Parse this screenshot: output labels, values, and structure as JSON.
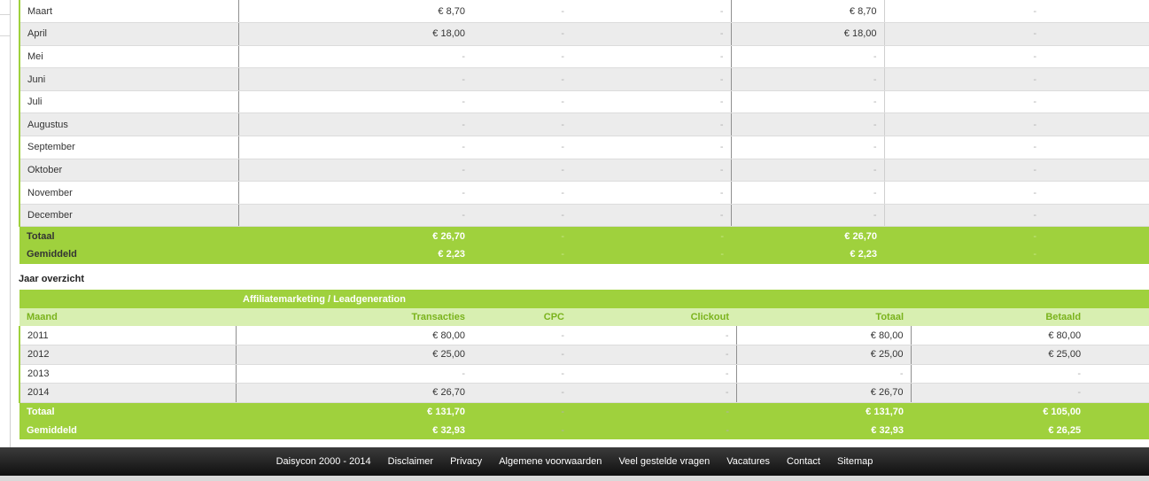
{
  "monthly": {
    "rows": [
      {
        "month": "Maart",
        "transacties": "€ 8,70",
        "cpc": "-",
        "clickout": "-",
        "totaal": "€ 8,70",
        "betaald": "-"
      },
      {
        "month": "April",
        "transacties": "€ 18,00",
        "cpc": "-",
        "clickout": "-",
        "totaal": "€ 18,00",
        "betaald": "-"
      },
      {
        "month": "Mei",
        "transacties": "-",
        "cpc": "-",
        "clickout": "-",
        "totaal": "-",
        "betaald": "-"
      },
      {
        "month": "Juni",
        "transacties": "-",
        "cpc": "-",
        "clickout": "-",
        "totaal": "-",
        "betaald": "-"
      },
      {
        "month": "Juli",
        "transacties": "-",
        "cpc": "-",
        "clickout": "-",
        "totaal": "-",
        "betaald": "-"
      },
      {
        "month": "Augustus",
        "transacties": "-",
        "cpc": "-",
        "clickout": "-",
        "totaal": "-",
        "betaald": "-"
      },
      {
        "month": "September",
        "transacties": "-",
        "cpc": "-",
        "clickout": "-",
        "totaal": "-",
        "betaald": "-"
      },
      {
        "month": "Oktober",
        "transacties": "-",
        "cpc": "-",
        "clickout": "-",
        "totaal": "-",
        "betaald": "-"
      },
      {
        "month": "November",
        "transacties": "-",
        "cpc": "-",
        "clickout": "-",
        "totaal": "-",
        "betaald": "-"
      },
      {
        "month": "December",
        "transacties": "-",
        "cpc": "-",
        "clickout": "-",
        "totaal": "-",
        "betaald": "-"
      }
    ],
    "totaal": {
      "label": "Totaal",
      "transacties": "€ 26,70",
      "cpc": "-",
      "clickout": "-",
      "totaal": "€ 26,70",
      "betaald": "-"
    },
    "gemiddeld": {
      "label": "Gemiddeld",
      "transacties": "€ 2,23",
      "cpc": "-",
      "clickout": "-",
      "totaal": "€ 2,23",
      "betaald": "-"
    }
  },
  "yearly": {
    "title": "Jaar overzicht",
    "group_header": "Affiliatemarketing / Leadgeneration",
    "columns": {
      "maand": "Maand",
      "transacties": "Transacties",
      "cpc": "CPC",
      "clickout": "Clickout",
      "totaal": "Totaal",
      "betaald": "Betaald"
    },
    "rows": [
      {
        "year": "2011",
        "transacties": "€ 80,00",
        "cpc": "-",
        "clickout": "-",
        "totaal": "€ 80,00",
        "betaald": "€ 80,00"
      },
      {
        "year": "2012",
        "transacties": "€ 25,00",
        "cpc": "-",
        "clickout": "-",
        "totaal": "€ 25,00",
        "betaald": "€ 25,00"
      },
      {
        "year": "2013",
        "transacties": "-",
        "cpc": "-",
        "clickout": "-",
        "totaal": "-",
        "betaald": "-"
      },
      {
        "year": "2014",
        "transacties": "€ 26,70",
        "cpc": "-",
        "clickout": "-",
        "totaal": "€ 26,70",
        "betaald": "-"
      }
    ],
    "totaal": {
      "label": "Totaal",
      "transacties": "€ 131,70",
      "cpc": "-",
      "clickout": "-",
      "totaal": "€ 131,70",
      "betaald": "€ 105,00"
    },
    "gemiddeld": {
      "label": "Gemiddeld",
      "transacties": "€ 32,93",
      "cpc": "-",
      "clickout": "-",
      "totaal": "€ 32,93",
      "betaald": "€ 26,25"
    }
  },
  "footer": {
    "copyright": "Daisycon 2000 - 2014",
    "links": [
      "Disclaimer",
      "Privacy",
      "Algemene voorwaarden",
      "Veel gestelde vragen",
      "Vacatures",
      "Contact",
      "Sitemap"
    ]
  },
  "colors": {
    "accent": "#9fd13d",
    "header_light": "#d8efb1",
    "header_text": "#7ab31c",
    "footer": "#1a1a1a"
  }
}
